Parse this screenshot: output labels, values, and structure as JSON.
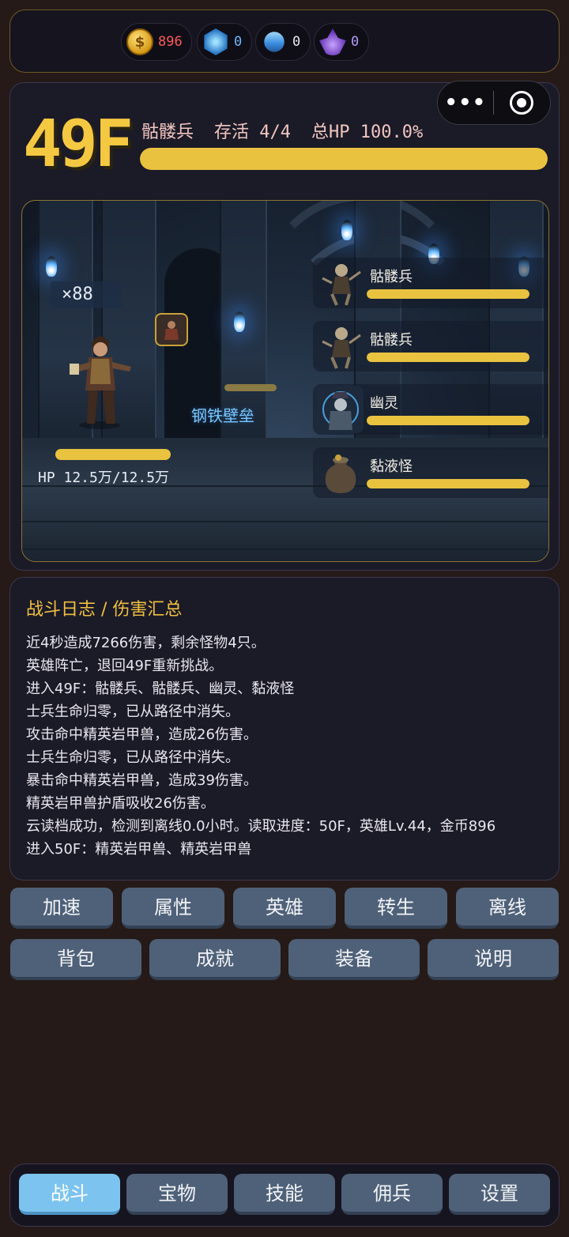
{
  "currency": [
    {
      "icon": "gold-coin-icon",
      "value": "896",
      "color": "#ff5a5a"
    },
    {
      "icon": "blue-hex-gem-icon",
      "value": "0",
      "color": "#6fb8ff"
    },
    {
      "icon": "blue-diamond-icon",
      "value": "0",
      "color": "#e8e8f0"
    },
    {
      "icon": "purple-crystal-icon",
      "value": "0",
      "color": "#b59cff"
    }
  ],
  "battle": {
    "floor": "49F",
    "enemy_name": "骷髅兵",
    "alive_label": "存活 4/4",
    "total_hp_label": "总HP 100.0%",
    "total_hp_fraction": 1.0
  },
  "hero": {
    "count": "×88",
    "hp_text": "HP 12.5万/12.5万",
    "hp_fraction": 1.0,
    "skill_name": "钢铁壁垒"
  },
  "enemies": [
    {
      "name": "骷髅兵",
      "hp_fraction": 1.0,
      "portrait": "skeleton-portrait-icon"
    },
    {
      "name": "骷髅兵",
      "hp_fraction": 1.0,
      "portrait": "skeleton-portrait-icon"
    },
    {
      "name": "幽灵",
      "hp_fraction": 1.0,
      "portrait": "ghost-portrait-icon"
    },
    {
      "name": "黏液怪",
      "hp_fraction": 1.0,
      "portrait": "slime-jar-portrait-icon"
    }
  ],
  "log": {
    "title": "战斗日志 / 伤害汇总",
    "lines": [
      "近4秒造成7266伤害，剩余怪物4只。",
      "英雄阵亡，退回49F重新挑战。",
      "进入49F：骷髅兵、骷髅兵、幽灵、黏液怪",
      "士兵生命归零，已从路径中消失。",
      "攻击命中精英岩甲兽，造成26伤害。",
      "士兵生命归零，已从路径中消失。",
      "暴击命中精英岩甲兽，造成39伤害。",
      "精英岩甲兽护盾吸收26伤害。",
      "云读档成功，检测到离线0.0小时。读取进度：50F，英雄Lv.44，金币896",
      "进入50F：精英岩甲兽、精英岩甲兽"
    ]
  },
  "actions_row1": [
    "加速",
    "属性",
    "英雄",
    "转生",
    "离线"
  ],
  "actions_row2": [
    "背包",
    "成就",
    "装备",
    "说明"
  ],
  "nav": [
    "战斗",
    "宝物",
    "技能",
    "佣兵",
    "设置"
  ],
  "nav_active": "战斗"
}
